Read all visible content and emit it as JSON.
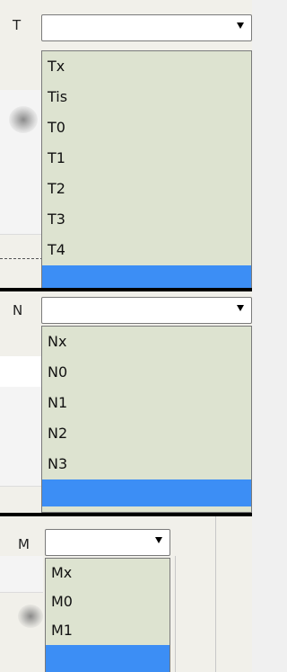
{
  "t_panel": {
    "label": "T",
    "selected_value": "",
    "options": [
      "Tx",
      "Tis",
      "T0",
      "T1",
      "T2",
      "T3",
      "T4",
      ""
    ]
  },
  "n_panel": {
    "label": "N",
    "selected_value": "",
    "options": [
      "Nx",
      "N0",
      "N1",
      "N2",
      "N3",
      ""
    ]
  },
  "m_panel": {
    "label": "M",
    "selected_value": "",
    "options": [
      "Mx",
      "M0",
      "M1",
      ""
    ]
  },
  "colors": {
    "list_background": "#dde3d0",
    "highlight": "#3c8ef5",
    "separator": "#000000"
  },
  "icons": {
    "dropdown_arrow": "chevron-down-icon"
  }
}
